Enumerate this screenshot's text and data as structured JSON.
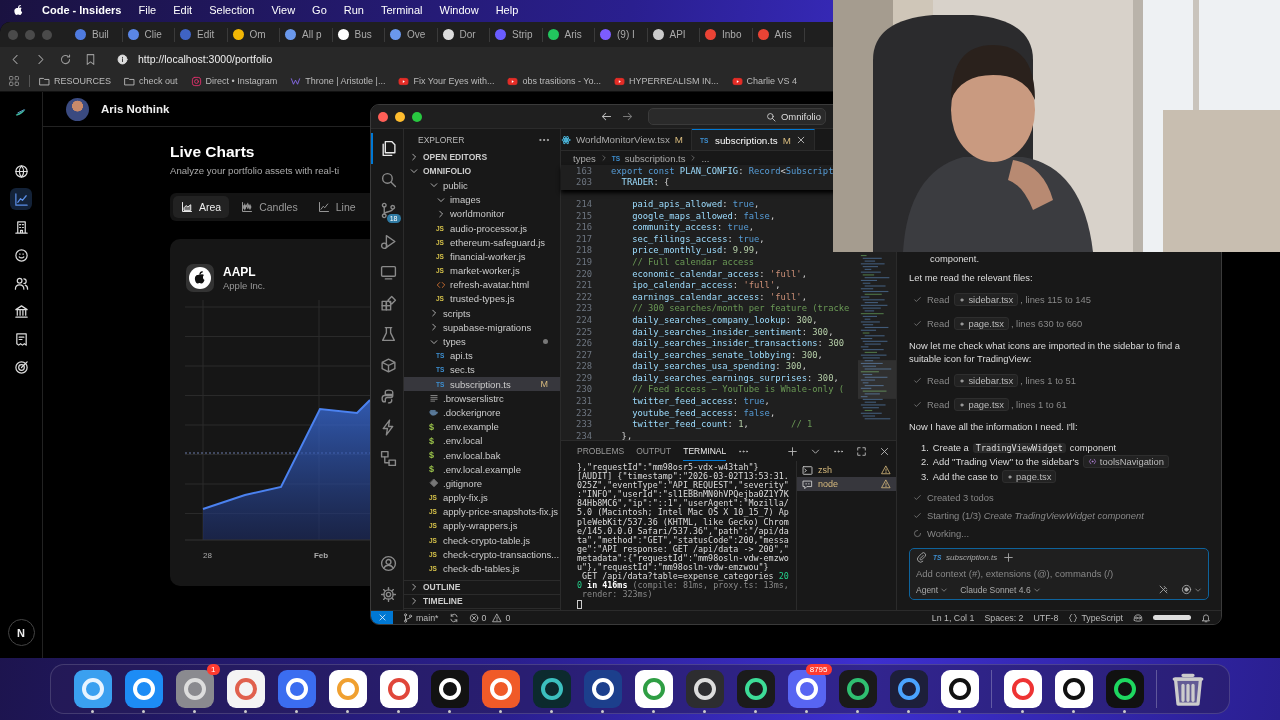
{
  "menu_bar": {
    "app": "Code - Insiders",
    "items": [
      "File",
      "Edit",
      "Selection",
      "View",
      "Go",
      "Run",
      "Terminal",
      "Window",
      "Help"
    ]
  },
  "browser": {
    "tabs": [
      {
        "label": "Buil",
        "color": "#4f7be0"
      },
      {
        "label": "Clie",
        "color": "#5a86e6"
      },
      {
        "label": "Edit",
        "color": "#3f63c4"
      },
      {
        "label": "Om",
        "color": "#f2b705"
      },
      {
        "label": "All p",
        "color": "#6a98ec"
      },
      {
        "label": "Bus",
        "color": "#ffffff"
      },
      {
        "label": "Ove",
        "color": "#6a98ec"
      },
      {
        "label": "Dor",
        "color": "#dddddd"
      },
      {
        "label": "Strip",
        "color": "#6a5cff"
      },
      {
        "label": "Aris",
        "color": "#22c55e"
      },
      {
        "label": "(9) I",
        "color": "#7c5cff"
      },
      {
        "label": "API",
        "color": "#cccccc"
      },
      {
        "label": "Inbo",
        "color": "#ea4335"
      },
      {
        "label": "Aris",
        "color": "#ea4335"
      }
    ],
    "url": "http://localhost:3000/portfolio",
    "bookmarks": [
      {
        "kind": "folder",
        "label": "RESOURCES"
      },
      {
        "kind": "folder",
        "label": "check out"
      },
      {
        "kind": "camera",
        "label": "Direct • Instagram"
      },
      {
        "kind": "wave",
        "label": "Throne | Aristotle |..."
      },
      {
        "kind": "video",
        "label": "Fix Your Eyes with..."
      },
      {
        "kind": "video",
        "label": "obs trasitions - Yo..."
      },
      {
        "kind": "video",
        "label": "HYPERREALISM IN..."
      },
      {
        "kind": "video",
        "label": "Charlie VS 4"
      }
    ]
  },
  "page": {
    "user": "Aris Nothink",
    "nav": [
      {
        "kind": "globe",
        "selected": false
      },
      {
        "kind": "chart",
        "selected": true
      },
      {
        "kind": "building",
        "selected": false
      },
      {
        "kind": "smile",
        "selected": false
      },
      {
        "kind": "people",
        "selected": false
      },
      {
        "kind": "bank",
        "selected": false
      },
      {
        "kind": "receipt",
        "selected": false
      },
      {
        "kind": "target",
        "selected": false
      }
    ],
    "title": "Live Charts",
    "subtitle": "Analyze your portfolio assets with real-ti",
    "chart_types": [
      {
        "kind": "area",
        "label": "Area",
        "selected": true
      },
      {
        "kind": "candles",
        "label": "Candles",
        "selected": false
      },
      {
        "kind": "line",
        "label": "Line",
        "selected": false
      }
    ],
    "asset": {
      "symbol": "AAPL",
      "name": "Apple Inc."
    },
    "x_labels": [
      "28",
      "Feb"
    ],
    "corner_badge": "N"
  },
  "vscode": {
    "search": "Omnifolio",
    "activity": [
      {
        "kind": "files",
        "selected": true
      },
      {
        "kind": "search",
        "selected": false
      },
      {
        "kind": "branch",
        "selected": false,
        "badge": "18"
      },
      {
        "kind": "debug",
        "selected": false
      },
      {
        "kind": "remote",
        "selected": false
      },
      {
        "kind": "extensions",
        "selected": false
      },
      {
        "kind": "flask",
        "selected": false
      },
      {
        "kind": "box",
        "selected": false
      },
      {
        "kind": "snake",
        "selected": false
      },
      {
        "kind": "bolt",
        "selected": false
      },
      {
        "kind": "nodes",
        "selected": false
      }
    ],
    "activity_bottom": [
      {
        "kind": "account"
      },
      {
        "kind": "gear"
      }
    ],
    "explorer": {
      "title": "EXPLORER",
      "sections": [
        {
          "label": "OPEN EDITORS",
          "expanded": false
        },
        {
          "label": "OMNIFOLIO",
          "expanded": true,
          "children": [
            {
              "kind": "folder",
              "label": "public",
              "expanded": true,
              "selected": false,
              "children": [
                {
                  "kind": "folder",
                  "label": "images",
                  "expanded": true,
                  "selected": false
                },
                {
                  "kind": "folder",
                  "label": "worldmonitor",
                  "expanded": false,
                  "selected": false
                },
                {
                  "kind": "js",
                  "icon": "JS",
                  "label": "audio-processor.js",
                  "selected": false
                },
                {
                  "kind": "js",
                  "icon": "JS",
                  "label": "ethereum-safeguard.js",
                  "selected": false
                },
                {
                  "kind": "js",
                  "icon": "JS",
                  "label": "financial-worker.js",
                  "selected": false
                },
                {
                  "kind": "js",
                  "icon": "JS",
                  "label": "market-worker.js",
                  "selected": false
                },
                {
                  "kind": "html",
                  "label": "refresh-avatar.html",
                  "selected": false
                },
                {
                  "kind": "js",
                  "icon": "JS",
                  "label": "trusted-types.js",
                  "selected": false
                }
              ]
            },
            {
              "kind": "folder",
              "label": "scripts",
              "expanded": false,
              "selected": false
            },
            {
              "kind": "folder",
              "label": "supabase-migrations",
              "expanded": false,
              "selected": false
            },
            {
              "kind": "folder",
              "label": "types",
              "expanded": true,
              "modified": true,
              "selected": false,
              "children": [
                {
                  "kind": "ts",
                  "icon": "TS",
                  "label": "api.ts",
                  "selected": false
                },
                {
                  "kind": "ts",
                  "icon": "TS",
                  "label": "sec.ts",
                  "selected": false
                },
                {
                  "kind": "ts",
                  "icon": "TS",
                  "label": "subscription.ts",
                  "badge": "M",
                  "selected": true
                }
              ]
            },
            {
              "kind": "list",
              "label": ".browserslistrc",
              "selected": false
            },
            {
              "kind": "whale",
              "label": ".dockerignore",
              "selected": false
            },
            {
              "kind": "env",
              "icon": "$",
              "label": ".env.example",
              "selected": false
            },
            {
              "kind": "env",
              "icon": "$",
              "label": ".env.local",
              "selected": false
            },
            {
              "kind": "env",
              "icon": "$",
              "label": ".env.local.bak",
              "selected": false
            },
            {
              "kind": "env",
              "icon": "$",
              "label": ".env.local.example",
              "selected": false
            },
            {
              "kind": "diamond",
              "label": ".gitignore",
              "selected": false
            },
            {
              "kind": "js",
              "icon": "JS",
              "label": "apply-fix.js",
              "selected": false
            },
            {
              "kind": "js",
              "icon": "JS",
              "label": "apply-price-snapshots-fix.js",
              "selected": false
            },
            {
              "kind": "js",
              "icon": "JS",
              "label": "apply-wrappers.js",
              "selected": false
            },
            {
              "kind": "js",
              "icon": "JS",
              "label": "check-crypto-table.js",
              "selected": false
            },
            {
              "kind": "js",
              "icon": "JS",
              "label": "check-crypto-transactions...",
              "selected": false
            },
            {
              "kind": "js",
              "icon": "JS",
              "label": "check-db-tables.js",
              "selected": false
            }
          ]
        }
      ],
      "bottom_sections": [
        {
          "label": "OUTLINE",
          "expanded": false
        },
        {
          "label": "TIMELINE",
          "expanded": false
        }
      ]
    },
    "editor": {
      "tabs": [
        {
          "kind": "react",
          "label": "WorldMonitorView.tsx",
          "badge": "M",
          "selected": false
        },
        {
          "kind": "ts",
          "icon": "TS",
          "label": "subscription.ts",
          "badge": "M",
          "selected": true
        }
      ],
      "breadcrumb": [
        {
          "label": "types"
        },
        {
          "icon": "TS",
          "label": "subscription.ts"
        },
        {
          "label": "..."
        }
      ],
      "sticky": [
        {
          "num": "163",
          "code": "export const PLAN_CONFIG: Record<Subscript"
        },
        {
          "num": "203",
          "code": "  TRADER: {"
        }
      ],
      "lines": [
        {
          "num": "214",
          "code": "    paid_apis_allowed: true,"
        },
        {
          "num": "215",
          "code": "    google_maps_allowed: false,"
        },
        {
          "num": "216",
          "code": "    community_access: true,"
        },
        {
          "num": "217",
          "code": "    sec_filings_access: true,"
        },
        {
          "num": "218",
          "code": "    price_monthly_usd: 9.99,"
        },
        {
          "num": "219",
          "code": "    // Full calendar access"
        },
        {
          "num": "220",
          "code": "    economic_calendar_access: 'full',"
        },
        {
          "num": "221",
          "code": "    ipo_calendar_access: 'full',"
        },
        {
          "num": "222",
          "code": "    earnings_calendar_access: 'full',"
        },
        {
          "num": "223",
          "code": "    // 300 searches/month per feature (tracke"
        },
        {
          "num": "224",
          "code": "    daily_searches_company_lookup: 300,"
        },
        {
          "num": "225",
          "code": "    daily_searches_insider_sentiment: 300,"
        },
        {
          "num": "226",
          "code": "    daily_searches_insider_transactions: 300"
        },
        {
          "num": "227",
          "code": "    daily_searches_senate_lobbying: 300,"
        },
        {
          "num": "228",
          "code": "    daily_searches_usa_spending: 300,"
        },
        {
          "num": "229",
          "code": "    daily_searches_earnings_surprises: 300,"
        },
        {
          "num": "230",
          "code": "    // Feed access — YouTube is Whale-only ("
        },
        {
          "num": "231",
          "code": "    twitter_feed_access: true,"
        },
        {
          "num": "232",
          "code": "    youtube_feed_access: false,"
        },
        {
          "num": "233",
          "code": "    twitter_feed_count: 1,        // 1"
        },
        {
          "num": "234",
          "code": "  },"
        }
      ]
    },
    "panel": {
      "tabs": [
        {
          "label": "PROBLEMS",
          "selected": false
        },
        {
          "label": "OUTPUT",
          "selected": false
        },
        {
          "label": "TERMINAL",
          "selected": true
        }
      ],
      "terminal_lines": [
        [
          {
            "s": "},\"requestId\":\"mm98osr5-vdx-w43tah\"}"
          }
        ],
        [
          {
            "s": "[AUDIT] {\"timestamp\":\"2026-03-02T13:53:31."
          }
        ],
        [
          {
            "s": "025Z\",\"eventType\":\"API_REQUEST\",\"severity\""
          }
        ],
        [
          {
            "s": ":\"INFO\",\"userId\":\"sl1EBBnMN0hVPQejba0Z1Y7K"
          }
        ],
        [
          {
            "s": "84Hb8MC6\",\"ip\":\"::1\",\"userAgent\":\"Mozilla/"
          }
        ],
        [
          {
            "s": "5.0 (Macintosh; Intel Mac OS X 10_15_7) Ap"
          }
        ],
        [
          {
            "s": "pleWebKit/537.36 (KHTML, like Gecko) Chrom"
          }
        ],
        [
          {
            "s": "e/145.0.0.0 Safari/537.36\",\"path\":\"/api/da"
          }
        ],
        [
          {
            "s": "ta\",\"method\":\"GET\",\"statusCode\":200,\"messa"
          }
        ],
        [
          {
            "s": "ge\":\"API response: GET /api/data -> 200\",\""
          }
        ],
        [
          {
            "s": "metadata\":{\"requestId\":\"mm98osln-vdw-emzwo"
          }
        ],
        [
          {
            "s": "u\"},\"requestId\":\"mm98osln-vdw-emzwou\"}"
          }
        ],
        [
          {
            "s": " GET /api/data?table=expense_categories "
          },
          {
            "kind": "green",
            "s": "20"
          }
        ],
        [
          {
            "kind": "green",
            "s": "0"
          },
          {
            "kind": "bold",
            "s": " in 416ms "
          },
          {
            "kind": "dim",
            "s": "(compile: 81ms, proxy.ts: 13ms,"
          }
        ],
        [
          {
            "kind": "dim",
            "s": " render: 323ms)"
          }
        ]
      ],
      "terminals": [
        {
          "kind": "shell",
          "label": "zsh",
          "selected": false
        },
        {
          "kind": "node",
          "label": "node",
          "selected": true
        }
      ]
    },
    "chat": {
      "items": [
        {
          "kind": "fragment",
          "text": "component."
        },
        {
          "kind": "text",
          "text": "Let me read the relevant files:"
        },
        {
          "kind": "tool",
          "verb": "Read",
          "file": "sidebar.tsx",
          "detail": ", lines 115 to 145"
        },
        {
          "kind": "tool",
          "verb": "Read",
          "file": "page.tsx",
          "detail": ", lines 630 to 660"
        },
        {
          "kind": "text",
          "text": "Now let me check what icons are imported in the sidebar to find a suitable icon for TradingView:"
        },
        {
          "kind": "tool",
          "verb": "Read",
          "file": "sidebar.tsx",
          "detail": ", lines 1 to 51"
        },
        {
          "kind": "tool",
          "verb": "Read",
          "file": "page.tsx",
          "detail": ", lines 1 to 61"
        },
        {
          "kind": "text",
          "text": "Now I have all the information I need. I'll:"
        },
        {
          "kind": "list",
          "entries": [
            {
              "num": "1.",
              "parts": [
                {
                  "kind": "plain",
                  "s": "Create a"
                },
                {
                  "kind": "code",
                  "s": "TradingViewWidget"
                },
                {
                  "kind": "plain",
                  "s": "component"
                }
              ]
            },
            {
              "num": "2.",
              "parts": [
                {
                  "kind": "plain",
                  "s": "Add \"Trading View\" to the sidebar's"
                },
                {
                  "kind": "symbol",
                  "s": "toolsNavigation"
                }
              ]
            },
            {
              "num": "3.",
              "parts": [
                {
                  "kind": "plain",
                  "s": "Add the case to"
                },
                {
                  "kind": "file",
                  "s": "page.tsx"
                }
              ]
            }
          ]
        },
        {
          "kind": "done",
          "text": "Created 3 todos"
        },
        {
          "kind": "done",
          "text": "Starting (1/3) *Create TradingViewWidget component*"
        },
        {
          "kind": "working",
          "text": "Working..."
        }
      ],
      "input": {
        "context": {
          "icon": "TS",
          "label": "subscription.ts"
        },
        "placeholder": "Add context (#), extensions (@), commands (/)",
        "mode": "Agent",
        "model": "Claude Sonnet 4.6"
      }
    },
    "status_bar": {
      "branch": "main*",
      "errors": "0",
      "warnings": "0",
      "right": [
        "Ln 1, Col 1",
        "Spaces: 2",
        "UTF-8"
      ],
      "language": "TypeScript"
    }
  },
  "dock": [
    {
      "kind": "finder",
      "running": true
    },
    {
      "kind": "store",
      "running": true
    },
    {
      "kind": "settings",
      "running": true,
      "badge": "1"
    },
    {
      "kind": "calendar",
      "running": true
    },
    {
      "kind": "mountain",
      "running": true
    },
    {
      "kind": "flower",
      "running": true
    },
    {
      "kind": "mail",
      "running": true
    },
    {
      "kind": "tv",
      "running": true
    },
    {
      "kind": "lion",
      "running": true
    },
    {
      "kind": "cross",
      "running": true
    },
    {
      "kind": "plane",
      "running": true
    },
    {
      "kind": "browser",
      "running": true
    },
    {
      "kind": "obs",
      "running": true
    },
    {
      "kind": "ring",
      "running": true
    },
    {
      "kind": "discord",
      "running": true,
      "badge": "8795"
    },
    {
      "kind": "code",
      "running": true
    },
    {
      "kind": "arc",
      "running": true
    },
    {
      "kind": "knot",
      "running": true
    },
    {
      "kind": "sep"
    },
    {
      "kind": "yandex",
      "running": true
    },
    {
      "kind": "cut",
      "running": true
    },
    {
      "kind": "spotify",
      "running": true
    },
    {
      "kind": "sep"
    },
    {
      "kind": "trash",
      "running": false
    }
  ]
}
